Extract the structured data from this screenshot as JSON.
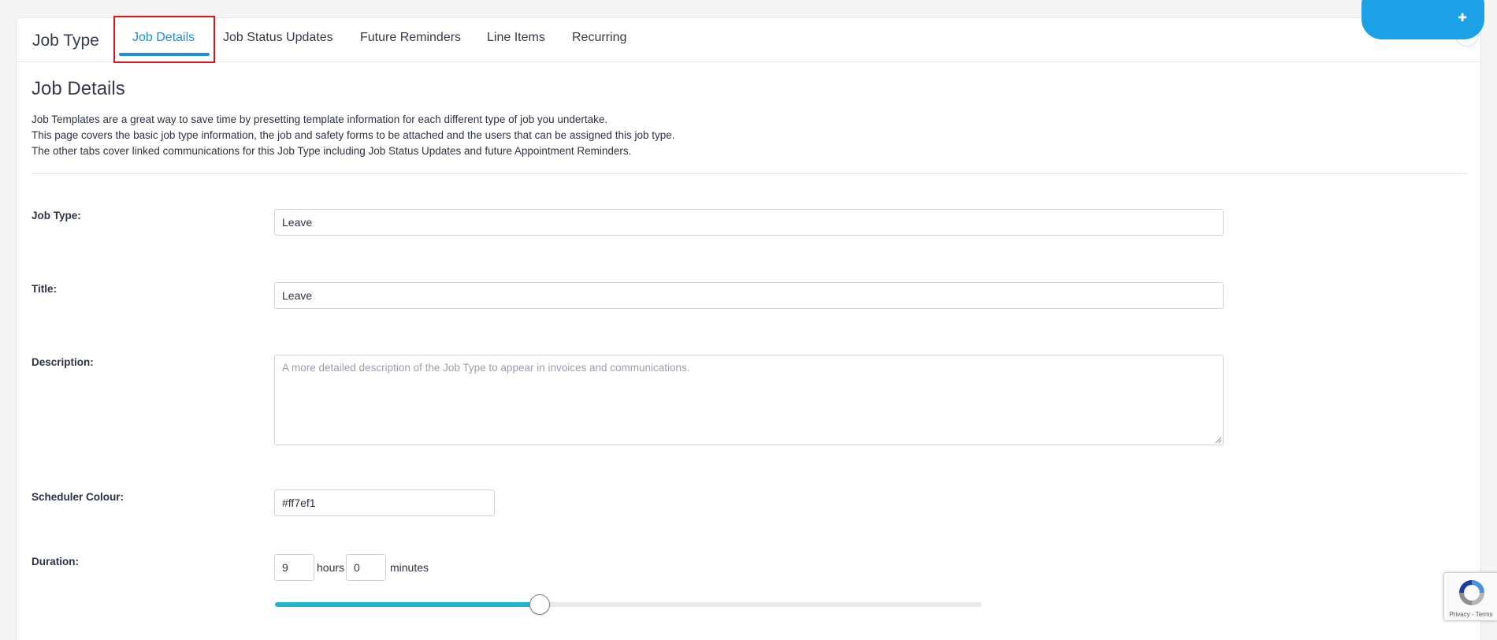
{
  "header": {
    "title": "Job Type",
    "tabs": [
      {
        "label": "Job Details",
        "active": true
      },
      {
        "label": "Job Status Updates",
        "active": false
      },
      {
        "label": "Future Reminders",
        "active": false
      },
      {
        "label": "Line Items",
        "active": false
      },
      {
        "label": "Recurring",
        "active": false
      }
    ],
    "video_icon": "video-camera-icon"
  },
  "section": {
    "title": "Job Details",
    "intro": [
      "Job Templates are a great way to save time by presetting template information for each different type of job you undertake.",
      "This page covers the basic job type information, the job and safety forms to be attached and the users that can be assigned this job type.",
      "The other tabs cover linked communications for this Job Type including Job Status Updates and future Appointment Reminders."
    ]
  },
  "form": {
    "job_type": {
      "label": "Job Type:",
      "value": "Leave"
    },
    "title": {
      "label": "Title:",
      "value": "Leave"
    },
    "description": {
      "label": "Description:",
      "value": "",
      "placeholder": "A more detailed description of the Job Type to appear in invoices and communications."
    },
    "scheduler_colour": {
      "label": "Scheduler Colour:",
      "value": "#ff7ef1"
    },
    "duration": {
      "label": "Duration:",
      "hours": "9",
      "hours_unit": "hours",
      "minutes": "0",
      "minutes_unit": "minutes",
      "slider_fraction": 0.375
    }
  },
  "recaptcha": {
    "text": "Privacy - Terms"
  },
  "colors": {
    "accent": "#1d8fe0",
    "slider_fill": "#1fb3d6",
    "highlight": "#e0141e",
    "top_button": "#1da1e6"
  }
}
